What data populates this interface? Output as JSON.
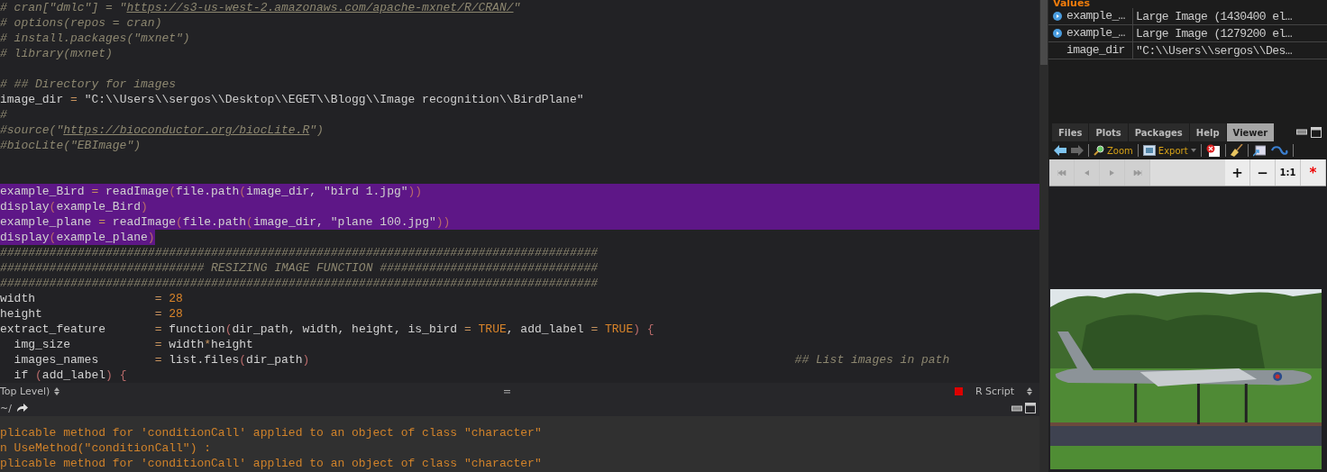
{
  "editor": {
    "lines": [
      {
        "selected": false,
        "segments": [
          {
            "kind": "comment",
            "text": "# cran[\"dmlc\"] = \""
          },
          {
            "kind": "link",
            "text": "https://s3-us-west-2.amazonaws.com/apache-mxnet/R/CRAN/"
          },
          {
            "kind": "comment",
            "text": "\""
          }
        ]
      },
      {
        "selected": false,
        "segments": [
          {
            "kind": "comment",
            "text": "# options(repos = cran)"
          }
        ]
      },
      {
        "selected": false,
        "segments": [
          {
            "kind": "comment",
            "text": "# install.packages(\"mxnet\")"
          }
        ]
      },
      {
        "selected": false,
        "segments": [
          {
            "kind": "comment",
            "text": "# library(mxnet)"
          }
        ]
      },
      {
        "kind": "blank"
      },
      {
        "selected": false,
        "segments": [
          {
            "kind": "comment",
            "text": "# ## Directory for images"
          }
        ]
      },
      {
        "selected": false,
        "segments": [
          {
            "kind": "plain",
            "text": "image_dir "
          },
          {
            "kind": "op",
            "text": "= "
          },
          {
            "kind": "string",
            "text": "\"C:\\\\Users\\\\sergos\\\\Desktop\\\\EGET\\\\Blogg\\\\Image recognition\\\\BirdPlane\""
          }
        ]
      },
      {
        "selected": false,
        "segments": [
          {
            "kind": "comment",
            "text": "#"
          }
        ]
      },
      {
        "selected": false,
        "segments": [
          {
            "kind": "comment",
            "text": "#source(\""
          },
          {
            "kind": "link",
            "text": "https://bioconductor.org/biocLite.R"
          },
          {
            "kind": "comment",
            "text": "\")"
          }
        ]
      },
      {
        "selected": false,
        "segments": [
          {
            "kind": "comment",
            "text": "#biocLite(\"EBImage\")"
          }
        ]
      },
      {
        "kind": "blank"
      },
      {
        "kind": "blank"
      },
      {
        "selected": true,
        "segments": [
          {
            "kind": "plain",
            "text": "example_Bird "
          },
          {
            "kind": "op",
            "text": "= "
          },
          {
            "kind": "plain",
            "text": "readImage"
          },
          {
            "kind": "paren",
            "text": "("
          },
          {
            "kind": "plain",
            "text": "file.path"
          },
          {
            "kind": "paren",
            "text": "("
          },
          {
            "kind": "plain",
            "text": "image_dir, "
          },
          {
            "kind": "string",
            "text": "\"bird 1.jpg\""
          },
          {
            "kind": "paren",
            "text": "))"
          }
        ]
      },
      {
        "selected": true,
        "segments": [
          {
            "kind": "plain",
            "text": "display"
          },
          {
            "kind": "paren",
            "text": "("
          },
          {
            "kind": "plain",
            "text": "example_Bird"
          },
          {
            "kind": "paren",
            "text": ")"
          }
        ]
      },
      {
        "selected": true,
        "segments": [
          {
            "kind": "plain",
            "text": "example_plane "
          },
          {
            "kind": "op",
            "text": "= "
          },
          {
            "kind": "plain",
            "text": "readImage"
          },
          {
            "kind": "paren",
            "text": "("
          },
          {
            "kind": "plain",
            "text": "file.path"
          },
          {
            "kind": "paren",
            "text": "("
          },
          {
            "kind": "plain",
            "text": "image_dir, "
          },
          {
            "kind": "string",
            "text": "\"plane 100.jpg\""
          },
          {
            "kind": "paren",
            "text": "))"
          }
        ]
      },
      {
        "selected": true,
        "segments": [
          {
            "kind": "plain",
            "text": "display"
          },
          {
            "kind": "paren",
            "text": "("
          },
          {
            "kind": "plain",
            "text": "example_plane"
          },
          {
            "kind": "paren",
            "text": ")"
          }
        ]
      },
      {
        "selected": false,
        "segments": [
          {
            "kind": "comment",
            "text": "#####################################################################################"
          }
        ]
      },
      {
        "selected": false,
        "segments": [
          {
            "kind": "comment",
            "text": "############################# RESIZING IMAGE FUNCTION ###############################"
          }
        ]
      },
      {
        "selected": false,
        "segments": [
          {
            "kind": "comment",
            "text": "#####################################################################################"
          }
        ]
      },
      {
        "selected": false,
        "segments": [
          {
            "kind": "plain",
            "text": "width                 "
          },
          {
            "kind": "op",
            "text": "= "
          },
          {
            "kind": "number",
            "text": "28"
          }
        ]
      },
      {
        "selected": false,
        "segments": [
          {
            "kind": "plain",
            "text": "height                "
          },
          {
            "kind": "op",
            "text": "= "
          },
          {
            "kind": "number",
            "text": "28"
          }
        ]
      },
      {
        "selected": false,
        "segments": [
          {
            "kind": "plain",
            "text": "extract_feature       "
          },
          {
            "kind": "op",
            "text": "= "
          },
          {
            "kind": "plain",
            "text": "function"
          },
          {
            "kind": "paren",
            "text": "("
          },
          {
            "kind": "plain",
            "text": "dir_path, width, height, is_bird "
          },
          {
            "kind": "op",
            "text": "= "
          },
          {
            "kind": "number",
            "text": "TRUE"
          },
          {
            "kind": "plain",
            "text": ", add_label "
          },
          {
            "kind": "op",
            "text": "= "
          },
          {
            "kind": "number",
            "text": "TRUE"
          },
          {
            "kind": "paren",
            "text": ") {"
          }
        ]
      },
      {
        "selected": false,
        "segments": [
          {
            "kind": "plain",
            "text": "  img_size            "
          },
          {
            "kind": "op",
            "text": "= "
          },
          {
            "kind": "plain",
            "text": "width"
          },
          {
            "kind": "op",
            "text": "*"
          },
          {
            "kind": "plain",
            "text": "height"
          }
        ]
      },
      {
        "selected": false,
        "segments": [
          {
            "kind": "plain",
            "text": "  images_names        "
          },
          {
            "kind": "op",
            "text": "= "
          },
          {
            "kind": "plain",
            "text": "list.files"
          },
          {
            "kind": "paren",
            "text": "("
          },
          {
            "kind": "plain",
            "text": "dir_path"
          },
          {
            "kind": "paren",
            "text": ")"
          },
          {
            "kind": "aside_comment",
            "text": "## List images in path"
          }
        ]
      },
      {
        "selected": false,
        "segments": [
          {
            "kind": "plain",
            "text": "  if "
          },
          {
            "kind": "paren",
            "text": "("
          },
          {
            "kind": "plain",
            "text": "add_label"
          },
          {
            "kind": "paren",
            "text": ") {"
          }
        ]
      }
    ]
  },
  "status_bar": {
    "scope": "Top Level)",
    "file_type": "R Script"
  },
  "console": {
    "path": "~/",
    "lines": [
      "plicable method for 'conditionCall' applied to an object of class \"character\"",
      "n UseMethod(\"conditionCall\") :",
      "plicable method for 'conditionCall' applied to an object of class \"character\""
    ]
  },
  "environment": {
    "section": "Values",
    "rows": [
      {
        "kind": "data",
        "name": "example_…",
        "value": "Large Image (1430400 el…"
      },
      {
        "kind": "data",
        "name": "example_…",
        "value": "Large Image (1279200 el…"
      },
      {
        "kind": "value",
        "name": "image_dir",
        "value": "\"C:\\\\Users\\\\sergos\\\\Des…"
      }
    ]
  },
  "tabs": [
    {
      "label": "Files",
      "selected": false
    },
    {
      "label": "Plots",
      "selected": false
    },
    {
      "label": "Packages",
      "selected": false
    },
    {
      "label": "Help",
      "selected": false
    },
    {
      "label": "Viewer",
      "selected": true
    }
  ],
  "toolbar": {
    "zoom": "Zoom",
    "export": "Export"
  },
  "viewer_nav": {
    "zoom_in": "+",
    "zoom_out": "−",
    "actual_size": "1:1",
    "reset": "*"
  }
}
